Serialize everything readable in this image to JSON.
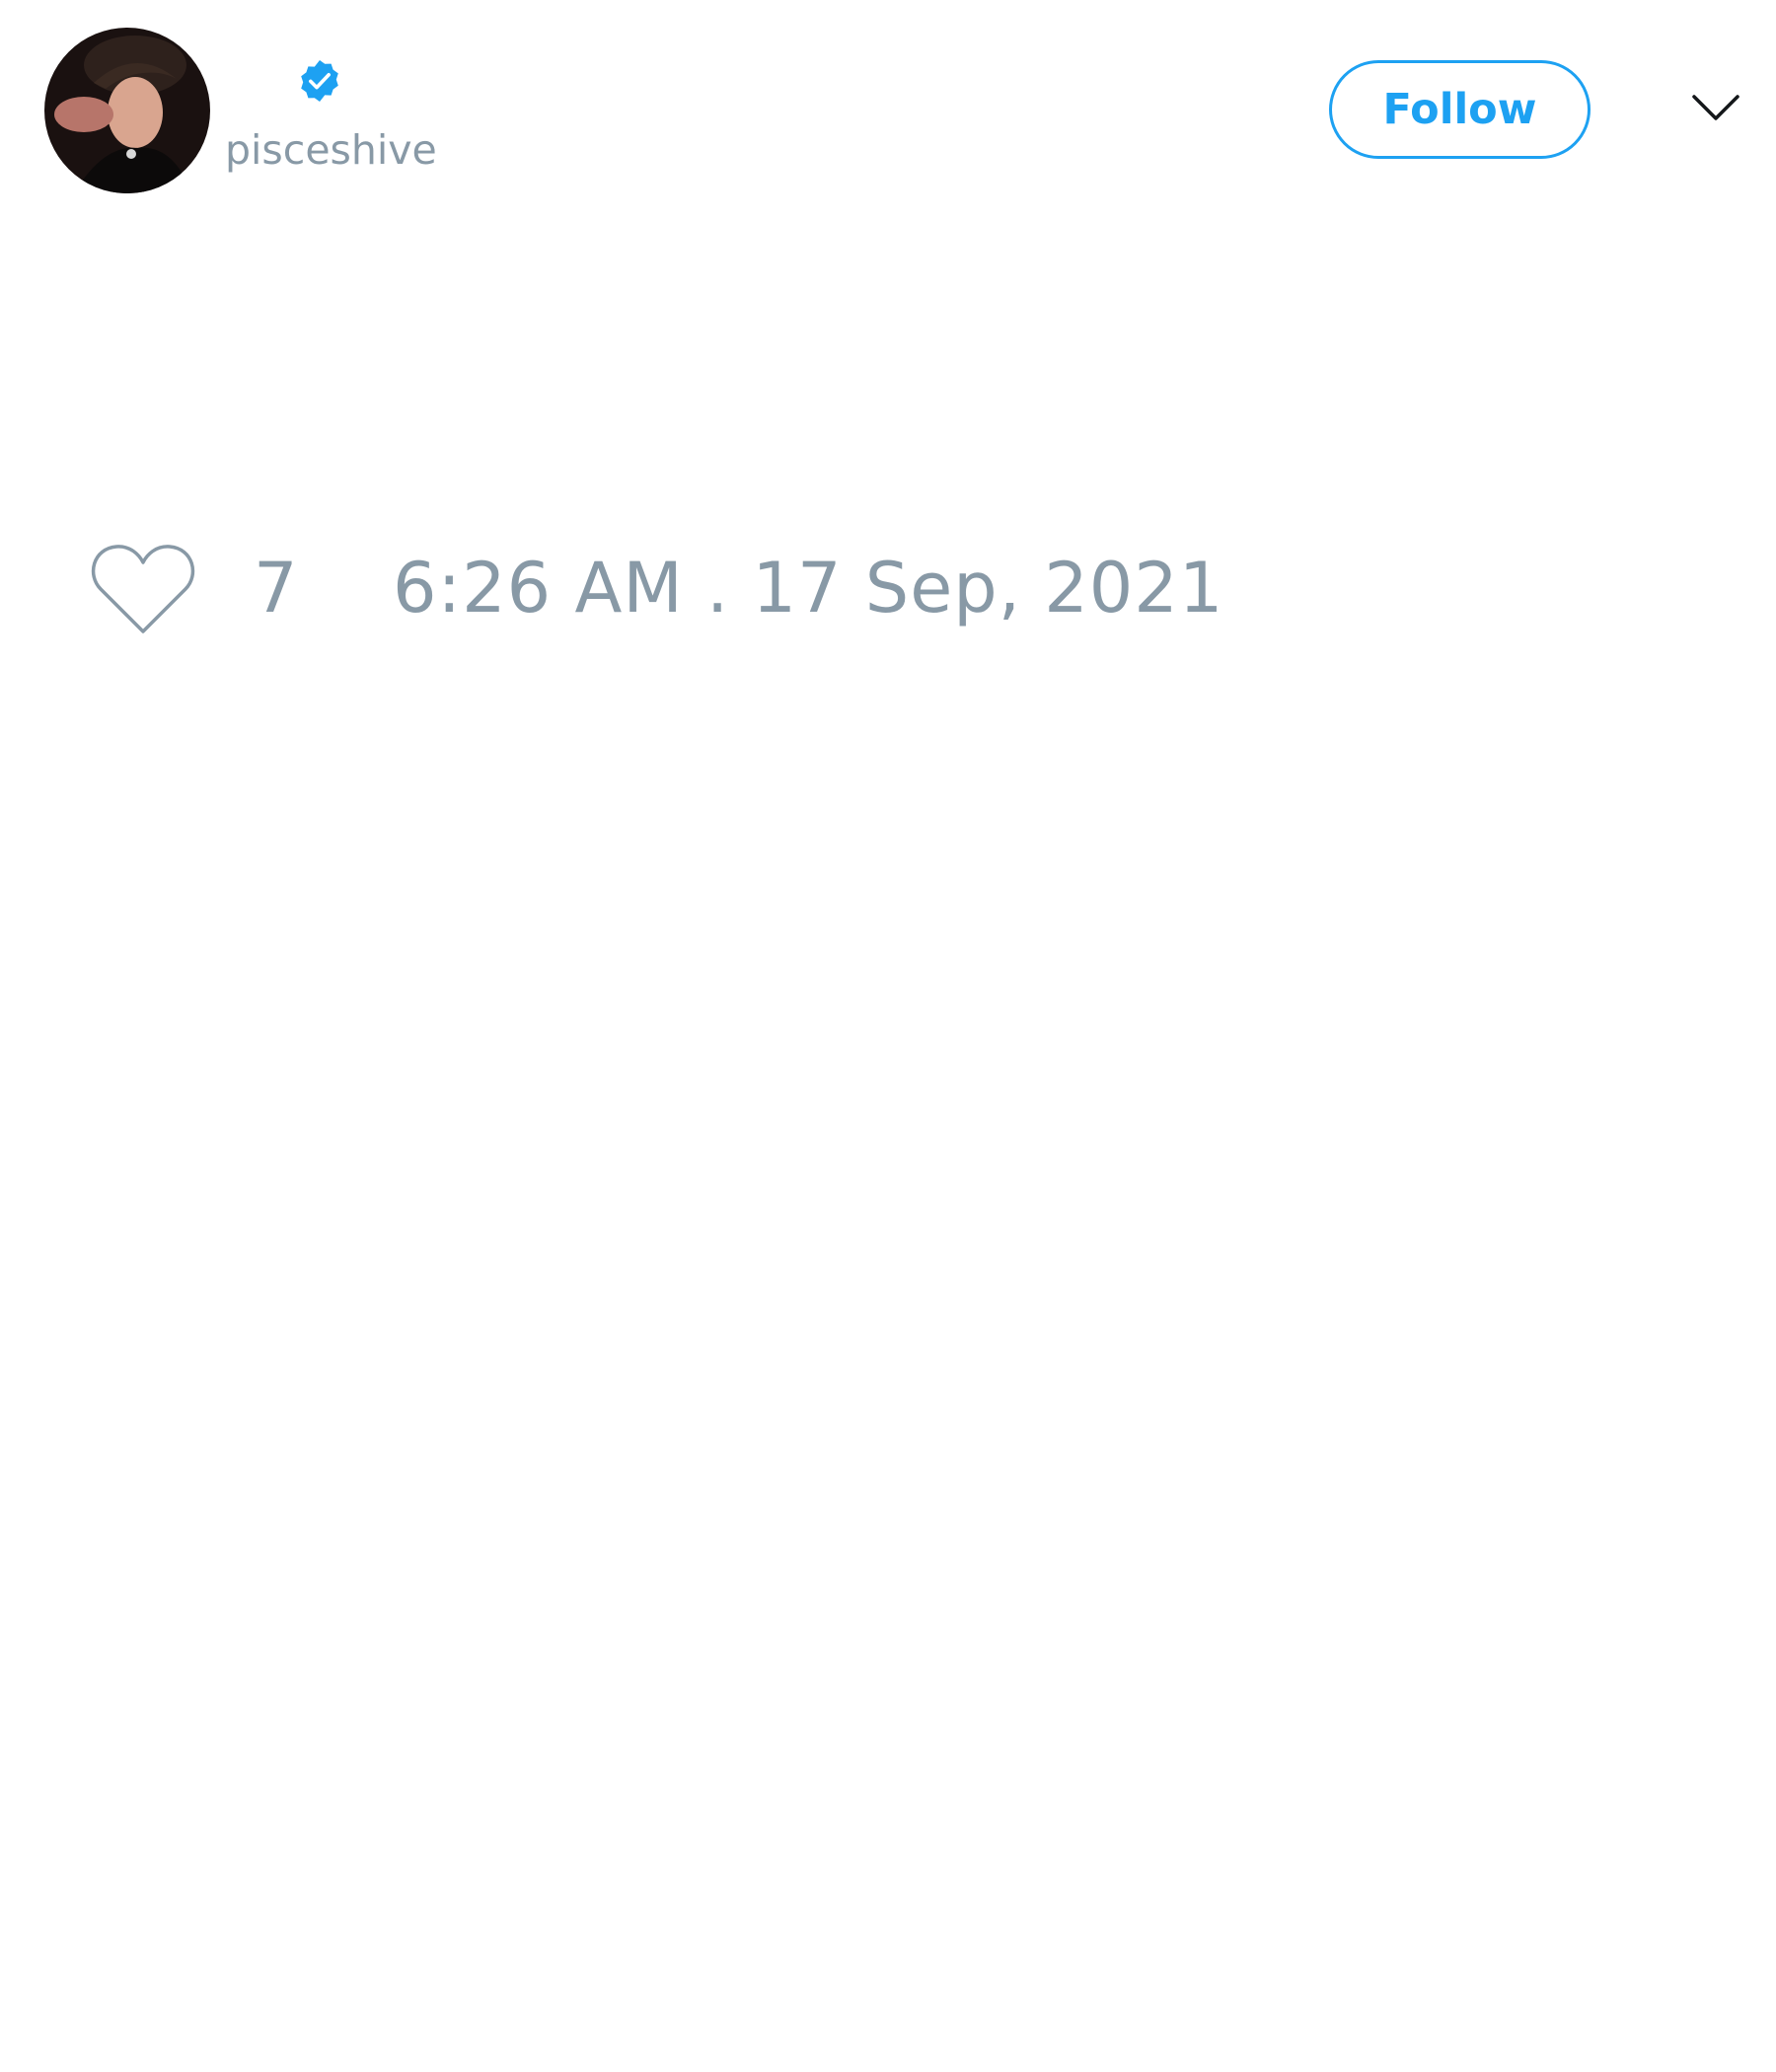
{
  "tweet": {
    "author": {
      "handle": "pisceshive",
      "verified": true,
      "avatar": "profile-photo"
    },
    "follow_label": "Follow",
    "menu_icon": "chevron-down-icon",
    "like_icon": "heart-icon",
    "like_count": "7",
    "timestamp": "6:26 AM . 17 Sep, 2021"
  },
  "colors": {
    "accent": "#1da1f2",
    "muted_text": "#8899a6",
    "background": "#ffffff"
  }
}
